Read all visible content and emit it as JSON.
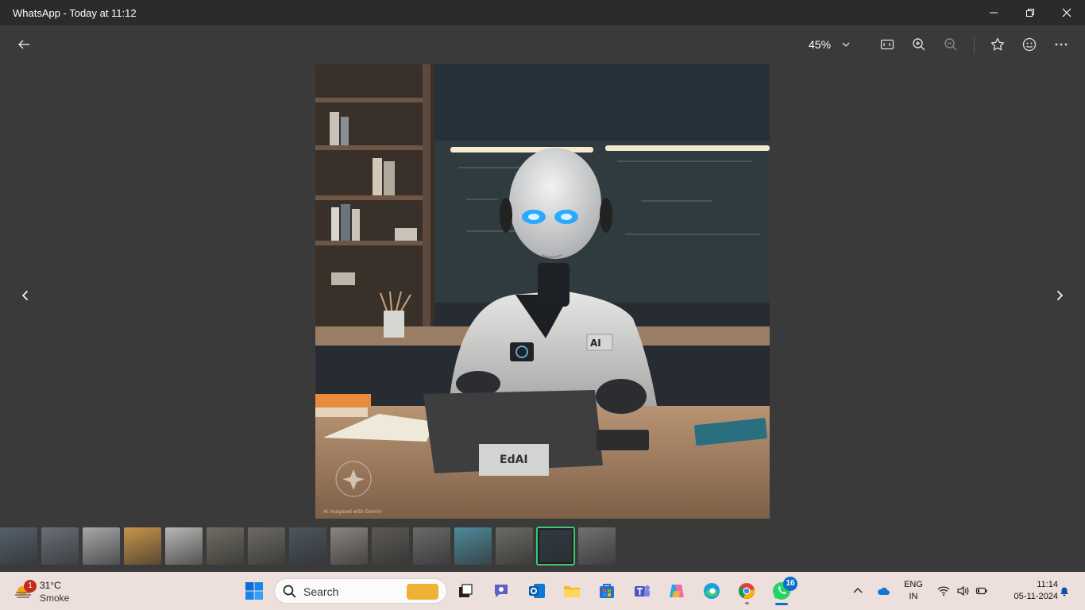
{
  "window": {
    "title": "WhatsApp - Today at 11:12"
  },
  "toolbar": {
    "zoom_label": "45%"
  },
  "photo": {
    "laptop_label": "EdAI",
    "coat_label": "AI",
    "watermark_text": "Al Imagined with Gemini"
  },
  "filmstrip": {
    "thumbs": [
      "#55606a",
      "#6a6f78",
      "#a6a8aa",
      "#c9954a",
      "#b7b7b5",
      "#6f6d62",
      "#6d6a64",
      "#4c5660",
      "#8a8580",
      "#5d5a54",
      "#6a6a6a",
      "#4f8a9a",
      "#6c6a66",
      "#2f3a44",
      "#6f7070"
    ],
    "active_index": 13
  },
  "taskbar": {
    "weather": {
      "temp": "31°C",
      "desc": "Smoke",
      "badge": "1"
    },
    "search_placeholder": "Search",
    "whatsapp_badge": "16",
    "lang_top": "ENG",
    "lang_bottom": "IN",
    "time": "11:14",
    "date": "05-11-2024"
  },
  "colors": {
    "accent": "#3fc774",
    "taskbar": "#ecdfdc",
    "background": "#3a3a3a"
  }
}
